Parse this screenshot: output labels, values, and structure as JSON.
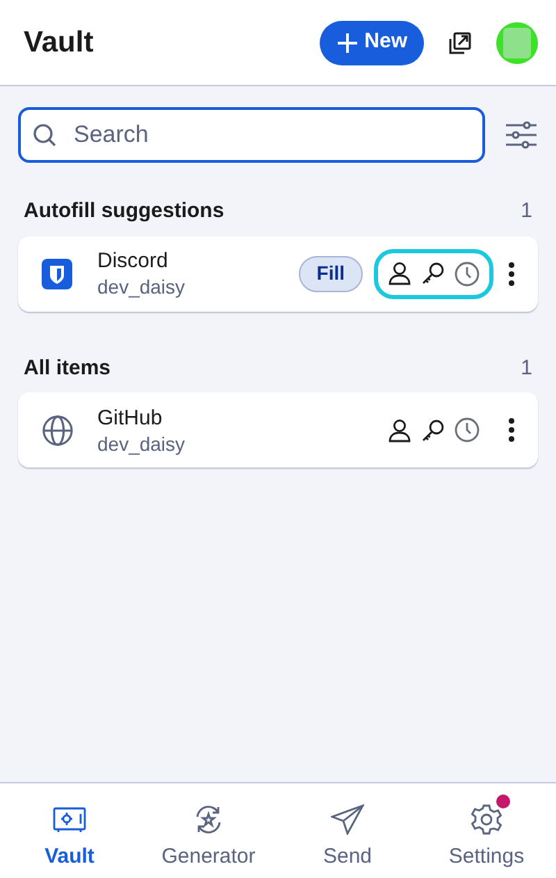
{
  "header": {
    "title": "Vault",
    "new_button": "New"
  },
  "search": {
    "placeholder": "Search"
  },
  "sections": [
    {
      "title": "Autofill suggestions",
      "count": "1",
      "items": [
        {
          "name": "Discord",
          "username": "dev_daisy",
          "kind": "shield",
          "fill_button": "Fill",
          "highlighted": true
        }
      ]
    },
    {
      "title": "All items",
      "count": "1",
      "items": [
        {
          "name": "GitHub",
          "username": "dev_daisy",
          "kind": "globe",
          "highlighted": false
        }
      ]
    }
  ],
  "nav": [
    {
      "label": "Vault",
      "kind": "vault",
      "selected": true,
      "badge": false
    },
    {
      "label": "Generator",
      "kind": "generator",
      "selected": false,
      "badge": false
    },
    {
      "label": "Send",
      "kind": "send",
      "selected": false,
      "badge": false
    },
    {
      "label": "Settings",
      "kind": "settings",
      "selected": false,
      "badge": true
    }
  ]
}
